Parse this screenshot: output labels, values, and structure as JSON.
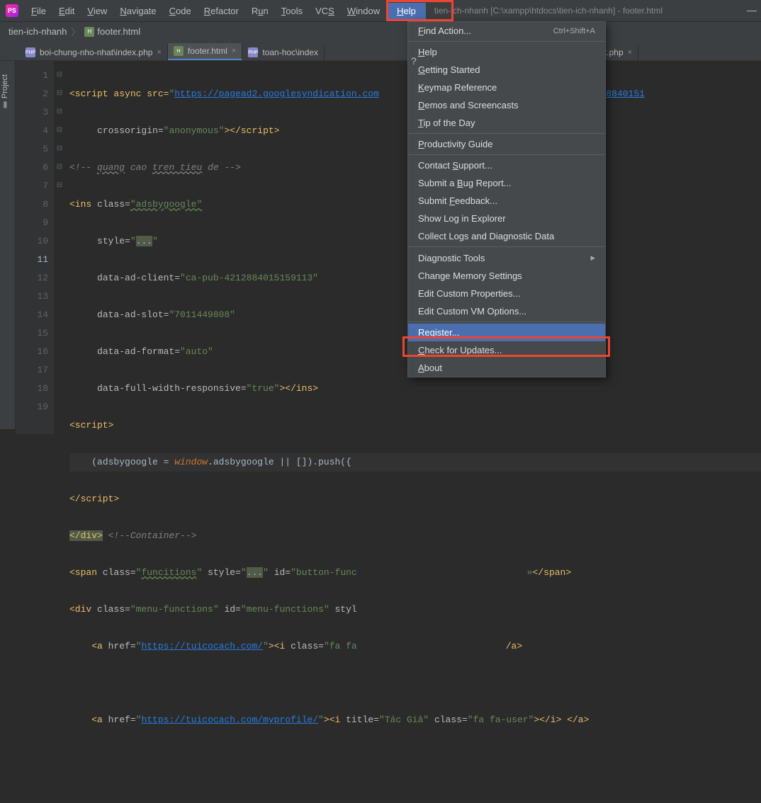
{
  "app": {
    "icon_label": "PS",
    "title": "tien-ich-nhanh [C:\\xampp\\htdocs\\tien-ich-nhanh] - footer.html"
  },
  "menubar": [
    "File",
    "Edit",
    "View",
    "Navigate",
    "Code",
    "Refactor",
    "Run",
    "Tools",
    "VCS",
    "Window",
    "Help"
  ],
  "crumbs": {
    "project": "tien-ich-nhanh",
    "file": "footer.html"
  },
  "tabs": [
    {
      "label": "boi-chung-nho-nhat\\index.php",
      "active": false
    },
    {
      "label": "footer.html",
      "active": true
    },
    {
      "label": "toan-hoc\\index",
      "active": false
    },
    {
      "label": "hp",
      "active": false
    },
    {
      "label": "khac\\index.php",
      "active": false
    }
  ],
  "side_label": "Project",
  "dropdown": {
    "find_action": "Find Action...",
    "find_shortcut": "Ctrl+Shift+A",
    "help": "Help",
    "getting_started": "Getting Started",
    "keymap": "Keymap Reference",
    "demos": "Demos and Screencasts",
    "tip": "Tip of the Day",
    "productivity": "Productivity Guide",
    "contact": "Contact Support...",
    "bug": "Submit a Bug Report...",
    "feedback": "Submit Feedback...",
    "showlog": "Show Log in Explorer",
    "collect": "Collect Logs and Diagnostic Data",
    "diag": "Diagnostic Tools",
    "memory": "Change Memory Settings",
    "props": "Edit Custom Properties...",
    "vm": "Edit Custom VM Options...",
    "register": "Register...",
    "updates": "Check for Updates...",
    "about": "About"
  },
  "gutter": [
    "1",
    "2",
    "3",
    "4",
    "5",
    "6",
    "7",
    "8",
    "9",
    "10",
    "11",
    "12",
    "13",
    "14",
    "15",
    "16",
    "17",
    "18",
    "19"
  ],
  "code": {
    "l1a": "<script async src=",
    "l1b": "\"",
    "l1c": "https://pagead2.googlesyndication.com",
    "l1d": "client=ca-pub-42128840151",
    "l2a": "crossorigin=",
    "l2b": "\"anonymous\"",
    "l2c": "></script>",
    "l3a": "<!-- ",
    "l3b": "quang",
    "l3c": " cao ",
    "l3d": "tren tieu",
    "l3e": " de -->",
    "l4a": "<ins ",
    "l4b": "class=",
    "l4c": "\"adsbygoogle\"",
    "l5a": "style=",
    "l5b": "\"",
    "l5c": "...",
    "l5d": "\"",
    "l6a": "data-ad-client=",
    "l6b": "\"ca-pub-4212884015159113\"",
    "l7a": "data-ad-slot=",
    "l7b": "\"7011449808\"",
    "l8a": "data-ad-format=",
    "l8b": "\"auto\"",
    "l9a": "data-full-width-responsive=",
    "l9b": "\"true\"",
    "l9c": "></ins>",
    "l10": "<script>",
    "l11a": "(adsbygoogle = ",
    "l11b": "window",
    "l11c": ".adsbygoogle || []).push({",
    "l12": "</script>",
    "l13a": "</div>",
    "l13b": " <!--Container-->",
    "l14a": "<span ",
    "l14b": "class=",
    "l14c": "\"",
    "l14d": "funcitions",
    "l14e": "\" ",
    "l14f": "style=",
    "l14g": "\"",
    "l14h": "...",
    "l14i": "\" ",
    "l14j": "id=",
    "l14k": "\"button-func",
    "l14l": "»",
    "l14m": "</span>",
    "l15a": "<div ",
    "l15b": "class=",
    "l15c": "\"menu-functions\" ",
    "l15d": "id=",
    "l15e": "\"menu-functions\" ",
    "l15f": "styl",
    "l16a": "<a ",
    "l16b": "href=",
    "l16c": "\"",
    "l16d": "https://tuicocach.com/",
    "l16e": "\"",
    "l16f": "><i ",
    "l16g": "class=",
    "l16h": "\"fa fa",
    "l16i": "/a>",
    "l17": "",
    "l18a": "<a ",
    "l18b": "href=",
    "l18c": "\"",
    "l18d": "https://tuicocach.com/myprofile/",
    "l18e": "\"",
    "l18f": "><i ",
    "l18g": "title=",
    "l18h": "\"Tác Giả\" ",
    "l18i": "class=",
    "l18j": "\"fa fa-user\"",
    "l18k": "></i> </a>"
  }
}
